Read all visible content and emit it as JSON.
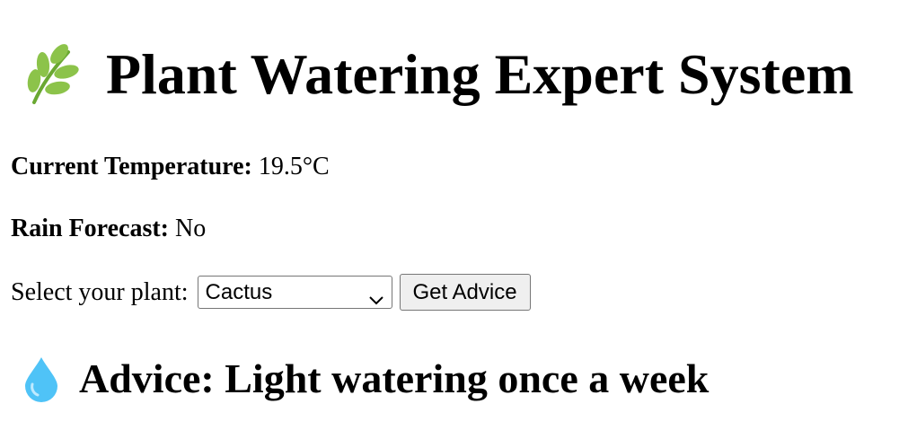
{
  "header": {
    "title": "Plant Watering Expert System",
    "icon": "herb-leaf-icon",
    "icon_color": "#8cc34a"
  },
  "weather": {
    "temperature_label": "Current Temperature:",
    "temperature_value": "19.5°C",
    "rain_label": "Rain Forecast:",
    "rain_value": "No"
  },
  "form": {
    "select_label": "Select your plant:",
    "selected_plant": "Cactus",
    "button_label": "Get Advice"
  },
  "advice": {
    "icon": "water-drop-icon",
    "icon_color": "#4fc3f7",
    "text": "Advice: Light watering once a week"
  }
}
